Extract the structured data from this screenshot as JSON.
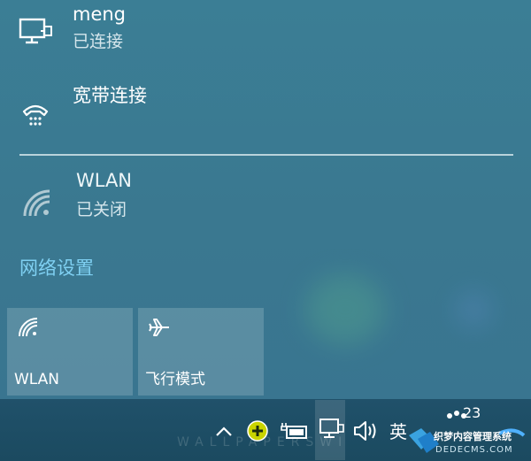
{
  "networks": [
    {
      "name": "meng",
      "status": "已连接",
      "icon": "ethernet-monitor-icon"
    },
    {
      "name": "宽带连接",
      "status": "",
      "icon": "dialup-phone-icon"
    },
    {
      "name": "WLAN",
      "status": "已关闭",
      "icon": "wifi-icon"
    }
  ],
  "settings_link": "网络设置",
  "quick_actions": [
    {
      "label": "WLAN",
      "icon": "wifi-icon"
    },
    {
      "label": "飞行模式",
      "icon": "airplane-icon"
    }
  ],
  "taskbar": {
    "ime_label": "英",
    "clock_partial": "23",
    "ghost_text": "WALLPAPERSWI"
  },
  "watermark": {
    "text": "织梦内容管理系统",
    "sub": "DEDECMS.COM"
  },
  "colors": {
    "flyout_bg": "#3b7e95",
    "accent_link": "#7fd0f2",
    "taskbar_bg": "#1b4a60"
  }
}
